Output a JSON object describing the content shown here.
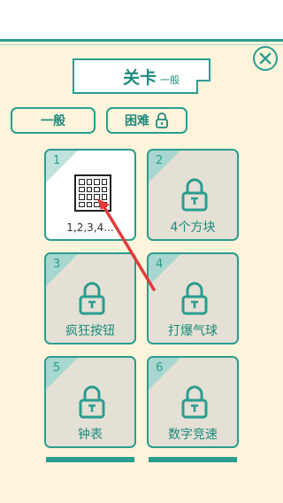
{
  "header": {
    "title": "关卡",
    "subtitle": "一般"
  },
  "tabs": [
    {
      "label": "一般"
    },
    {
      "label": "困难"
    }
  ],
  "levels": [
    {
      "number": "1",
      "label": "1,2,3,4...",
      "locked": false
    },
    {
      "number": "2",
      "label": "4个方块",
      "locked": true
    },
    {
      "number": "3",
      "label": "疯狂按钮",
      "locked": true
    },
    {
      "number": "4",
      "label": "打爆气球",
      "locked": true
    },
    {
      "number": "5",
      "label": "钟表",
      "locked": true
    },
    {
      "number": "6",
      "label": "数字竞速",
      "locked": true
    }
  ],
  "colors": {
    "accent": "#2a9d8f",
    "panel": "#fdf4dc",
    "card_locked": "#e4e0d5",
    "overlay_arrow": "#e03a3a"
  },
  "icons": {
    "close": "close-icon",
    "lock": "lock-icon",
    "grid": "number-grid-icon"
  }
}
